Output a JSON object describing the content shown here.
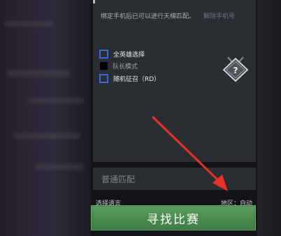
{
  "settings": {
    "bind_notice": "绑定手机后已可以进行天梯匹配。",
    "bind_link": "解除手机号",
    "options": [
      {
        "label": "全英雄选择",
        "checked": false
      },
      {
        "label": "队长模式",
        "checked": true
      },
      {
        "label": "随机征召（RD）",
        "checked": false
      }
    ],
    "mode_icon": "question-diamond-icon"
  },
  "match_mode": "普通匹配",
  "footer": {
    "language_label": "选择语言",
    "region_label": "地区：自动",
    "find_match_label": "寻找比赛"
  },
  "colors": {
    "find_button": "#4a8b4e",
    "annotation_arrow": "#e8302a",
    "focus_outline": "#3c67d8"
  }
}
